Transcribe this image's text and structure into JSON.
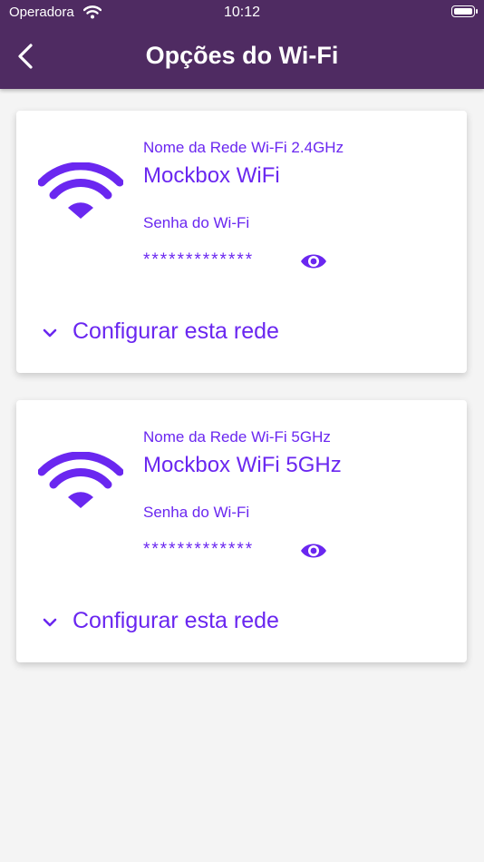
{
  "status_bar": {
    "carrier": "Operadora",
    "time": "10:12"
  },
  "header": {
    "title": "Opções do Wi-Fi"
  },
  "networks": [
    {
      "name_label": "Nome da Rede Wi-Fi 2.4GHz",
      "name": "Mockbox WiFi",
      "password_label": "Senha do Wi-Fi",
      "password_masked": "*************",
      "configure_label": "Configurar esta rede"
    },
    {
      "name_label": "Nome da Rede Wi-Fi 5GHz",
      "name": "Mockbox WiFi 5GHz",
      "password_label": "Senha do Wi-Fi",
      "password_masked": "*************",
      "configure_label": "Configurar esta rede"
    }
  ],
  "colors": {
    "header_bg": "#4f2b62",
    "accent": "#6a27f0",
    "page_bg": "#f4f4f4"
  }
}
